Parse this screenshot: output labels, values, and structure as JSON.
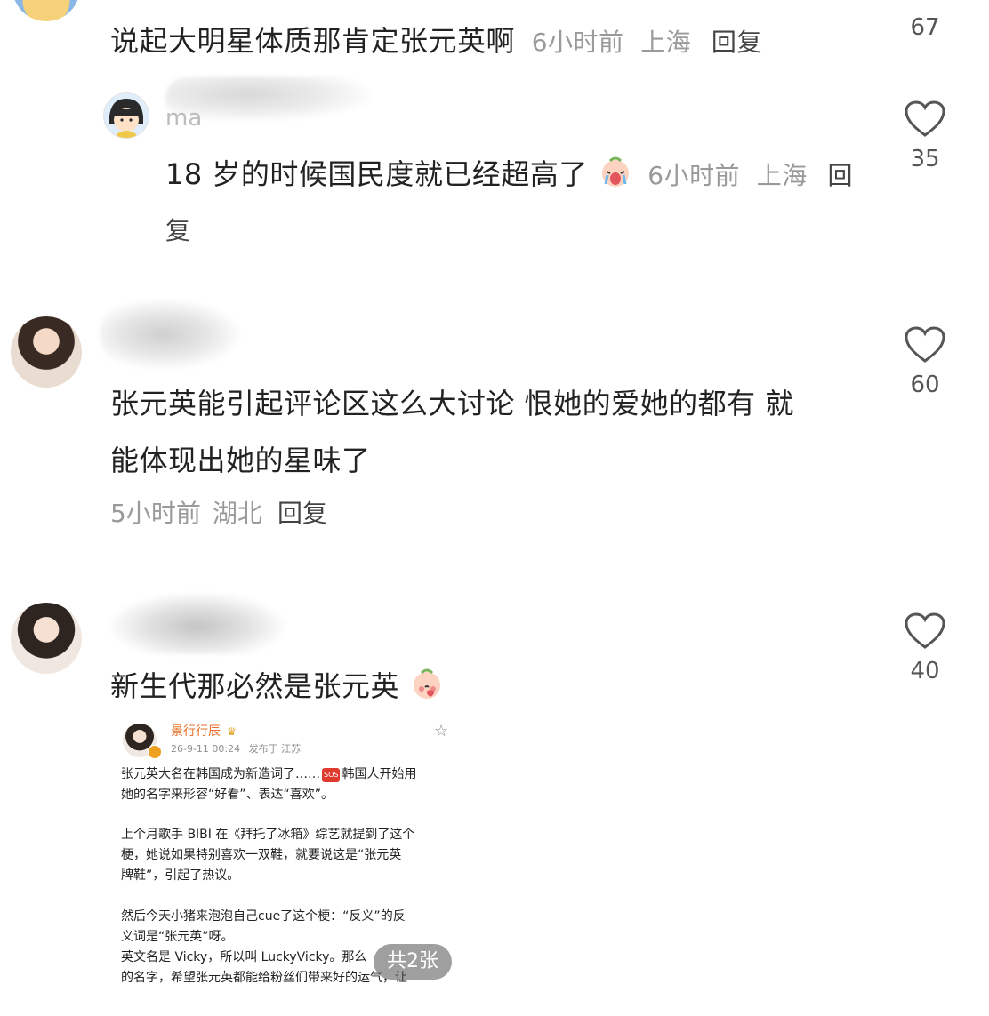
{
  "comments": [
    {
      "text": "说起大明星体质那肯定张元英啊",
      "time": "6小时前",
      "location": "上海",
      "reply": "回复",
      "likes": "67"
    },
    {
      "text": "18 岁的时候国民度就已经超高了",
      "time": "6小时前",
      "location": "上海",
      "reply_line1": "回",
      "reply_line2": "复",
      "likes": "35",
      "username_partial": "ma"
    },
    {
      "text_line1": "张元英能引起评论区这么大讨论 恨她的爱她的都有 就",
      "text_line2": "能体现出她的星味了",
      "time": "5小时前",
      "location": "湖北",
      "reply": "回复",
      "likes": "60"
    },
    {
      "text": "新生代那必然是张元英",
      "likes": "40",
      "attachment": {
        "author": "景行行辰",
        "date": "26-9-11 00:24",
        "posted_from": "发布于 江苏",
        "p1_a": "张元英大名在韩国成为新造词了……",
        "p1_badge": "SOS",
        "p1_b": "韩国人开始用",
        "p1_c": "她的名字来形容“好看”、表达“喜欢”。",
        "p2_a": "上个月歌手 BIBI 在《拜托了冰箱》综艺就提到了这个",
        "p2_b": "梗，她说如果特别喜欢一双鞋，就要说这是“张元英",
        "p2_c": "牌鞋”，引起了热议。",
        "p3_a": "然后今天小猪来泡泡自己cue了这个梗：“反义”的反",
        "p3_b": "义词是“张元英”呀。",
        "p3_c": "英文名是 Vicky，所以叫 LuckyVicky。那么",
        "p3_d": "的名字，希望张元英都能给粉丝们带来好的运气，让",
        "image_count": "共2张"
      }
    }
  ],
  "icons": {
    "like": "heart-outline-icon",
    "emoji": "crying-baby-emoji",
    "star": "star-outline-icon"
  },
  "colors": {
    "meta_gray": "#9a9a9a",
    "author_orange": "#e8702a",
    "sos_red": "#e03a2e"
  }
}
